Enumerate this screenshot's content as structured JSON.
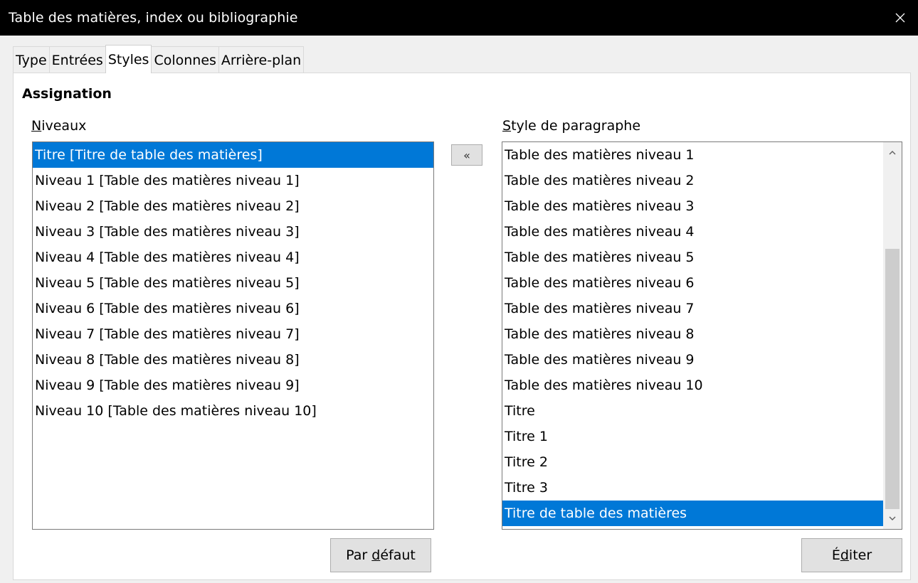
{
  "window": {
    "title": "Table des matières, index ou bibliographie"
  },
  "tabs": [
    {
      "label": "Type"
    },
    {
      "label": "Entrées"
    },
    {
      "label": "Styles"
    },
    {
      "label": "Colonnes"
    },
    {
      "label": "Arrière-plan"
    }
  ],
  "active_tab": "Styles",
  "section": {
    "title": "Assignation"
  },
  "levels": {
    "label_underlined": "N",
    "label_rest": "iveaux",
    "items": [
      "Titre [Titre de table des matières]",
      "Niveau 1 [Table des matières niveau 1]",
      "Niveau 2 [Table des matières niveau 2]",
      "Niveau 3 [Table des matières niveau 3]",
      "Niveau 4 [Table des matières niveau 4]",
      "Niveau 5 [Table des matières niveau 5]",
      "Niveau 6 [Table des matières niveau 6]",
      "Niveau 7 [Table des matières niveau 7]",
      "Niveau 8 [Table des matières niveau 8]",
      "Niveau 9 [Table des matières niveau 9]",
      "Niveau 10 [Table des matières niveau 10]"
    ],
    "selected_index": 0
  },
  "assign_button": {
    "label": "«"
  },
  "paragraph_styles": {
    "label_underlined": "S",
    "label_rest": "tyle de paragraphe",
    "items": [
      "Table des matières niveau 1",
      "Table des matières niveau 2",
      "Table des matières niveau 3",
      "Table des matières niveau 4",
      "Table des matières niveau 5",
      "Table des matières niveau 6",
      "Table des matières niveau 7",
      "Table des matières niveau 8",
      "Table des matières niveau 9",
      "Table des matières niveau 10",
      "Titre",
      "Titre 1",
      "Titre 2",
      "Titre 3",
      "Titre de table des matières"
    ],
    "selected_index": 14
  },
  "buttons": {
    "default_before": "Par ",
    "default_underlined": "d",
    "default_after": "éfaut",
    "edit_before": "É",
    "edit_underlined": "d",
    "edit_after": "iter"
  },
  "icons": {
    "close": "close-icon",
    "scroll_up": "chevron-up-icon",
    "scroll_down": "chevron-down-icon"
  },
  "colors": {
    "selection": "#0078d7",
    "titlebar": "#000000"
  }
}
